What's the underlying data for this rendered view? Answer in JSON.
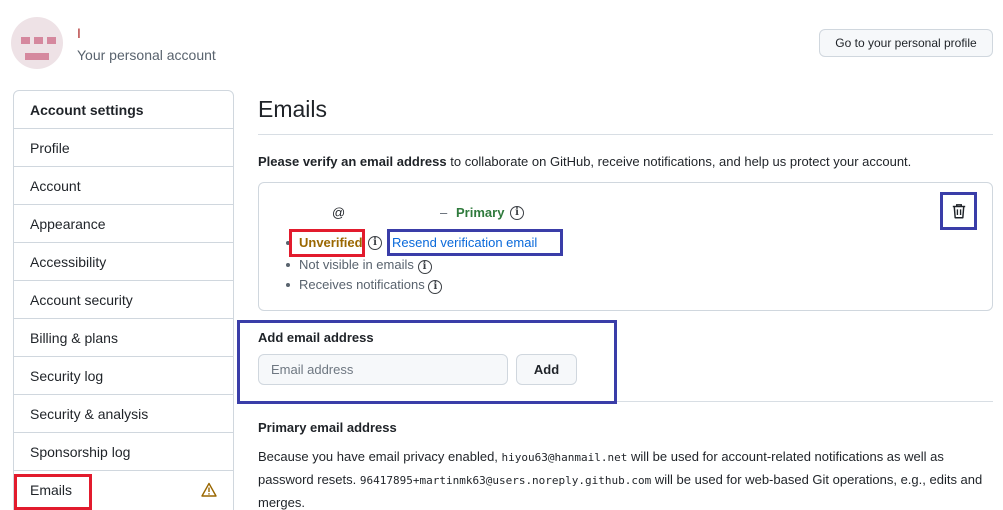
{
  "account": {
    "name": "I",
    "subtitle": "Your personal account",
    "profile_button": "Go to your personal profile"
  },
  "sidebar": {
    "heading": "Account settings",
    "items": [
      {
        "label": "Profile"
      },
      {
        "label": "Account"
      },
      {
        "label": "Appearance"
      },
      {
        "label": "Accessibility"
      },
      {
        "label": "Account security"
      },
      {
        "label": "Billing & plans"
      },
      {
        "label": "Security log"
      },
      {
        "label": "Security & analysis"
      },
      {
        "label": "Sponsorship log"
      },
      {
        "label": "Emails",
        "warning": true
      }
    ]
  },
  "main": {
    "title": "Emails",
    "verify_bold": "Please verify an email address",
    "verify_rest": " to collaborate on GitHub, receive notifications, and help us protect your account.",
    "email": {
      "address": "@",
      "dash": "–",
      "primary_label": "Primary",
      "status": "Unverified",
      "resend_link": "Resend verification email",
      "visibility": "Not visible in emails",
      "notifications": "Receives notifications"
    },
    "add_email": {
      "label": "Add email address",
      "placeholder": "Email address",
      "button": "Add"
    },
    "primary_section": {
      "label": "Primary email address",
      "desc_1": "Because you have email privacy enabled, ",
      "email_1": "hiyou63@hanmail.net",
      "desc_2": " will be used for account-related notifications as well as password resets. ",
      "email_2": "96417895+martinmk63@users.noreply.github.com",
      "desc_3": " will be used for web-based Git operations, e.g., edits and merges."
    }
  },
  "colors": {
    "primary_green": "#2f7a3c",
    "unverified_amber": "#9a6700",
    "link_blue": "#0969da",
    "highlight_red": "#e21b2d",
    "highlight_blue": "#3a3da8"
  },
  "icons": [
    "avatar",
    "info-icon",
    "trash-icon",
    "warning-icon"
  ]
}
